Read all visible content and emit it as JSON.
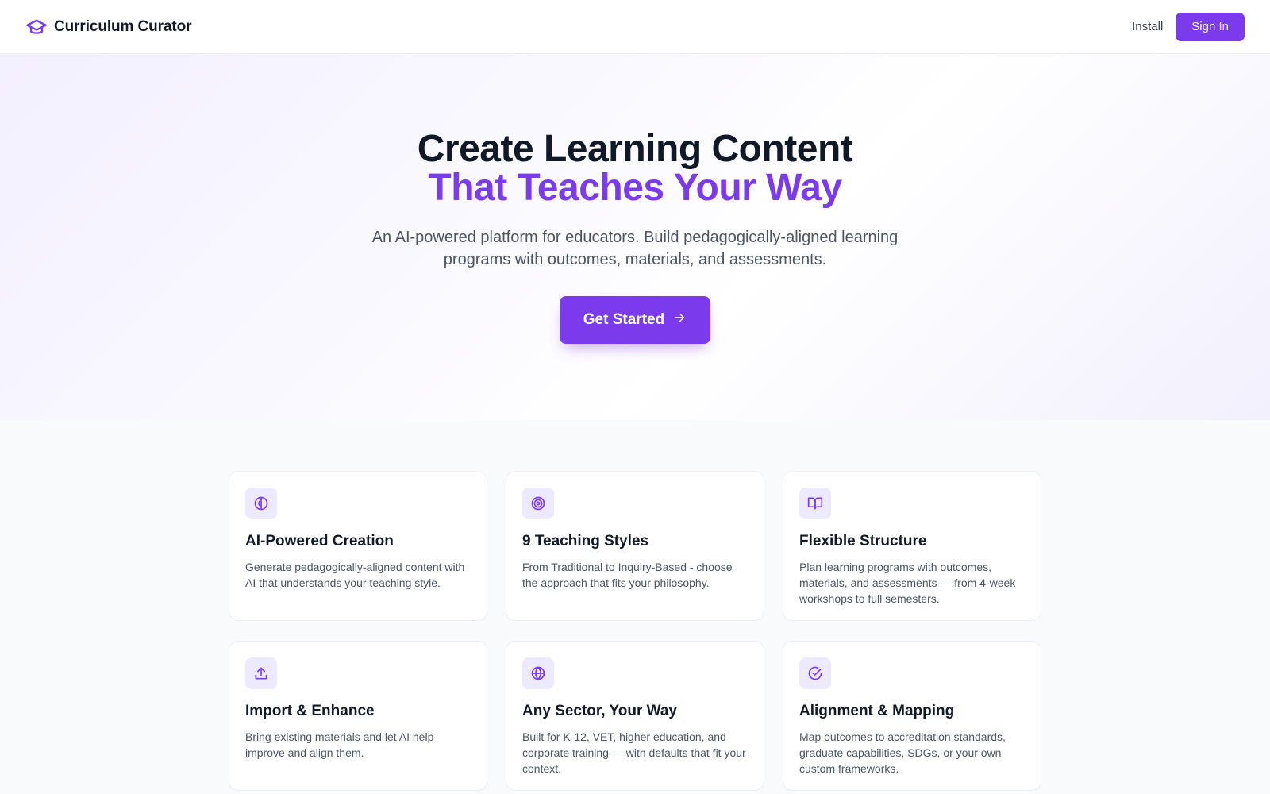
{
  "header": {
    "app_name": "Curriculum Curator",
    "logo_icon": "graduation-cap-icon",
    "install_label": "Install",
    "signin_label": "Sign In"
  },
  "hero": {
    "title_line1": "Create Learning Content",
    "title_line2": "That Teaches Your Way",
    "subtitle": "An AI-powered platform for educators. Build pedagogically-aligned learning programs with outcomes, materials, and assessments.",
    "cta_label": "Get Started",
    "cta_icon": "arrow-right-icon"
  },
  "features": [
    {
      "icon": "brain-icon",
      "title": "AI-Powered Creation",
      "description": "Generate pedagogically-aligned content with AI that understands your teaching style."
    },
    {
      "icon": "target-icon",
      "title": "9 Teaching Styles",
      "description": "From Traditional to Inquiry-Based - choose the approach that fits your philosophy."
    },
    {
      "icon": "book-open-icon",
      "title": "Flexible Structure",
      "description": "Plan learning programs with outcomes, materials, and assessments — from 4-week workshops to full semesters."
    },
    {
      "icon": "upload-icon",
      "title": "Import & Enhance",
      "description": "Bring existing materials and let AI help improve and align them."
    },
    {
      "icon": "globe-icon",
      "title": "Any Sector, Your Way",
      "description": "Built for K-12, VET, higher education, and corporate training — with defaults that fit your context."
    },
    {
      "icon": "check-circle-icon",
      "title": "Alignment & Mapping",
      "description": "Map outcomes to accreditation standards, graduate capabilities, SDGs, or your own custom frameworks."
    }
  ],
  "colors": {
    "accent": "#7c3aed",
    "icon_bg": "#ede9fe",
    "heading": "#111827",
    "body_text": "#4b5563"
  }
}
